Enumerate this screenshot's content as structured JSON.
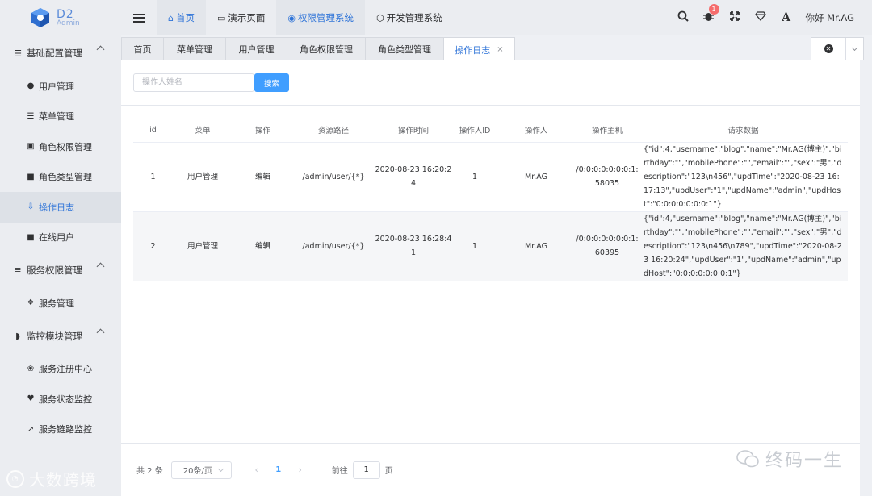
{
  "header": {
    "logo": {
      "title": "D2",
      "subtitle": "Admin"
    },
    "nav": [
      {
        "label": "首页",
        "icon": "home-icon"
      },
      {
        "label": "演示页面",
        "icon": "folder-icon"
      },
      {
        "label": "权限管理系统",
        "icon": "chrome-icon"
      },
      {
        "label": "开发管理系统",
        "icon": "cube-icon"
      }
    ],
    "notification_count": "1",
    "greeting": "你好 Mr.AG"
  },
  "sidebar": {
    "groups": [
      {
        "label": "基础配置管理",
        "icon": "list-icon",
        "items": [
          {
            "label": "用户管理",
            "icon": "user-icon"
          },
          {
            "label": "菜单管理",
            "icon": "menu-list-icon"
          },
          {
            "label": "角色权限管理",
            "icon": "id-card-icon"
          },
          {
            "label": "角色类型管理",
            "icon": "lock-icon"
          },
          {
            "label": "操作日志",
            "icon": "file-download-icon",
            "active": true
          },
          {
            "label": "在线用户",
            "icon": "lock-icon"
          }
        ]
      },
      {
        "label": "服务权限管理",
        "icon": "server-icon",
        "items": [
          {
            "label": "服务管理",
            "icon": "cubes-icon"
          }
        ]
      },
      {
        "label": "监控模块管理",
        "icon": "shield-icon",
        "items": [
          {
            "label": "服务注册中心",
            "icon": "paw-icon"
          },
          {
            "label": "服务状态监控",
            "icon": "heartbeat-icon"
          },
          {
            "label": "服务链路监控",
            "icon": "line-chart-icon"
          }
        ]
      }
    ]
  },
  "tabs": [
    {
      "label": "首页"
    },
    {
      "label": "菜单管理"
    },
    {
      "label": "用户管理"
    },
    {
      "label": "角色权限管理"
    },
    {
      "label": "角色类型管理"
    },
    {
      "label": "操作日志",
      "active": true,
      "close": "×"
    }
  ],
  "search": {
    "placeholder": "操作人姓名",
    "button": "搜索"
  },
  "table": {
    "columns": [
      "id",
      "菜单",
      "操作",
      "资源路径",
      "操作时间",
      "操作人ID",
      "操作人",
      "操作主机",
      "请求数据"
    ],
    "rows": [
      {
        "id": "1",
        "menu": "用户管理",
        "action": "编辑",
        "path": "/admin/user/{*}",
        "time": "2020-08-23 16:20:24",
        "operator_id": "1",
        "operator": "Mr.AG",
        "host": "/0:0:0:0:0:0:0:1:58035",
        "request": "{\"id\":4,\"username\":\"blog\",\"name\":\"Mr.AG(博主)\",\"birthday\":\"\",\"mobilePhone\":\"\",\"email\":\"\",\"sex\":\"男\",\"description\":\"123\\n456\",\"updTime\":\"2020-08-23 16:17:13\",\"updUser\":\"1\",\"updName\":\"admin\",\"updHost\":\"0:0:0:0:0:0:0:1\"}"
      },
      {
        "id": "2",
        "menu": "用户管理",
        "action": "编辑",
        "path": "/admin/user/{*}",
        "time": "2020-08-23 16:28:41",
        "operator_id": "1",
        "operator": "Mr.AG",
        "host": "/0:0:0:0:0:0:0:1:60395",
        "request": "{\"id\":4,\"username\":\"blog\",\"name\":\"Mr.AG(博主)\",\"birthday\":\"\",\"mobilePhone\":\"\",\"email\":\"\",\"sex\":\"男\",\"description\":\"123\\n456\\n789\",\"updTime\":\"2020-08-23 16:20:24\",\"updUser\":\"1\",\"updName\":\"admin\",\"updHost\":\"0:0:0:0:0:0:0:1\"}"
      }
    ]
  },
  "pagination": {
    "total": "共 2 条",
    "page_size": "20条/页",
    "current_page": "1",
    "goto_label": "前往",
    "goto_value": "1",
    "page_unit": "页"
  },
  "watermarks": {
    "left": "大数跨境",
    "right": "终码一生"
  },
  "colors": {
    "accent": "#2f74d8",
    "primary_button": "#409eff",
    "badge": "#f56c6c"
  }
}
